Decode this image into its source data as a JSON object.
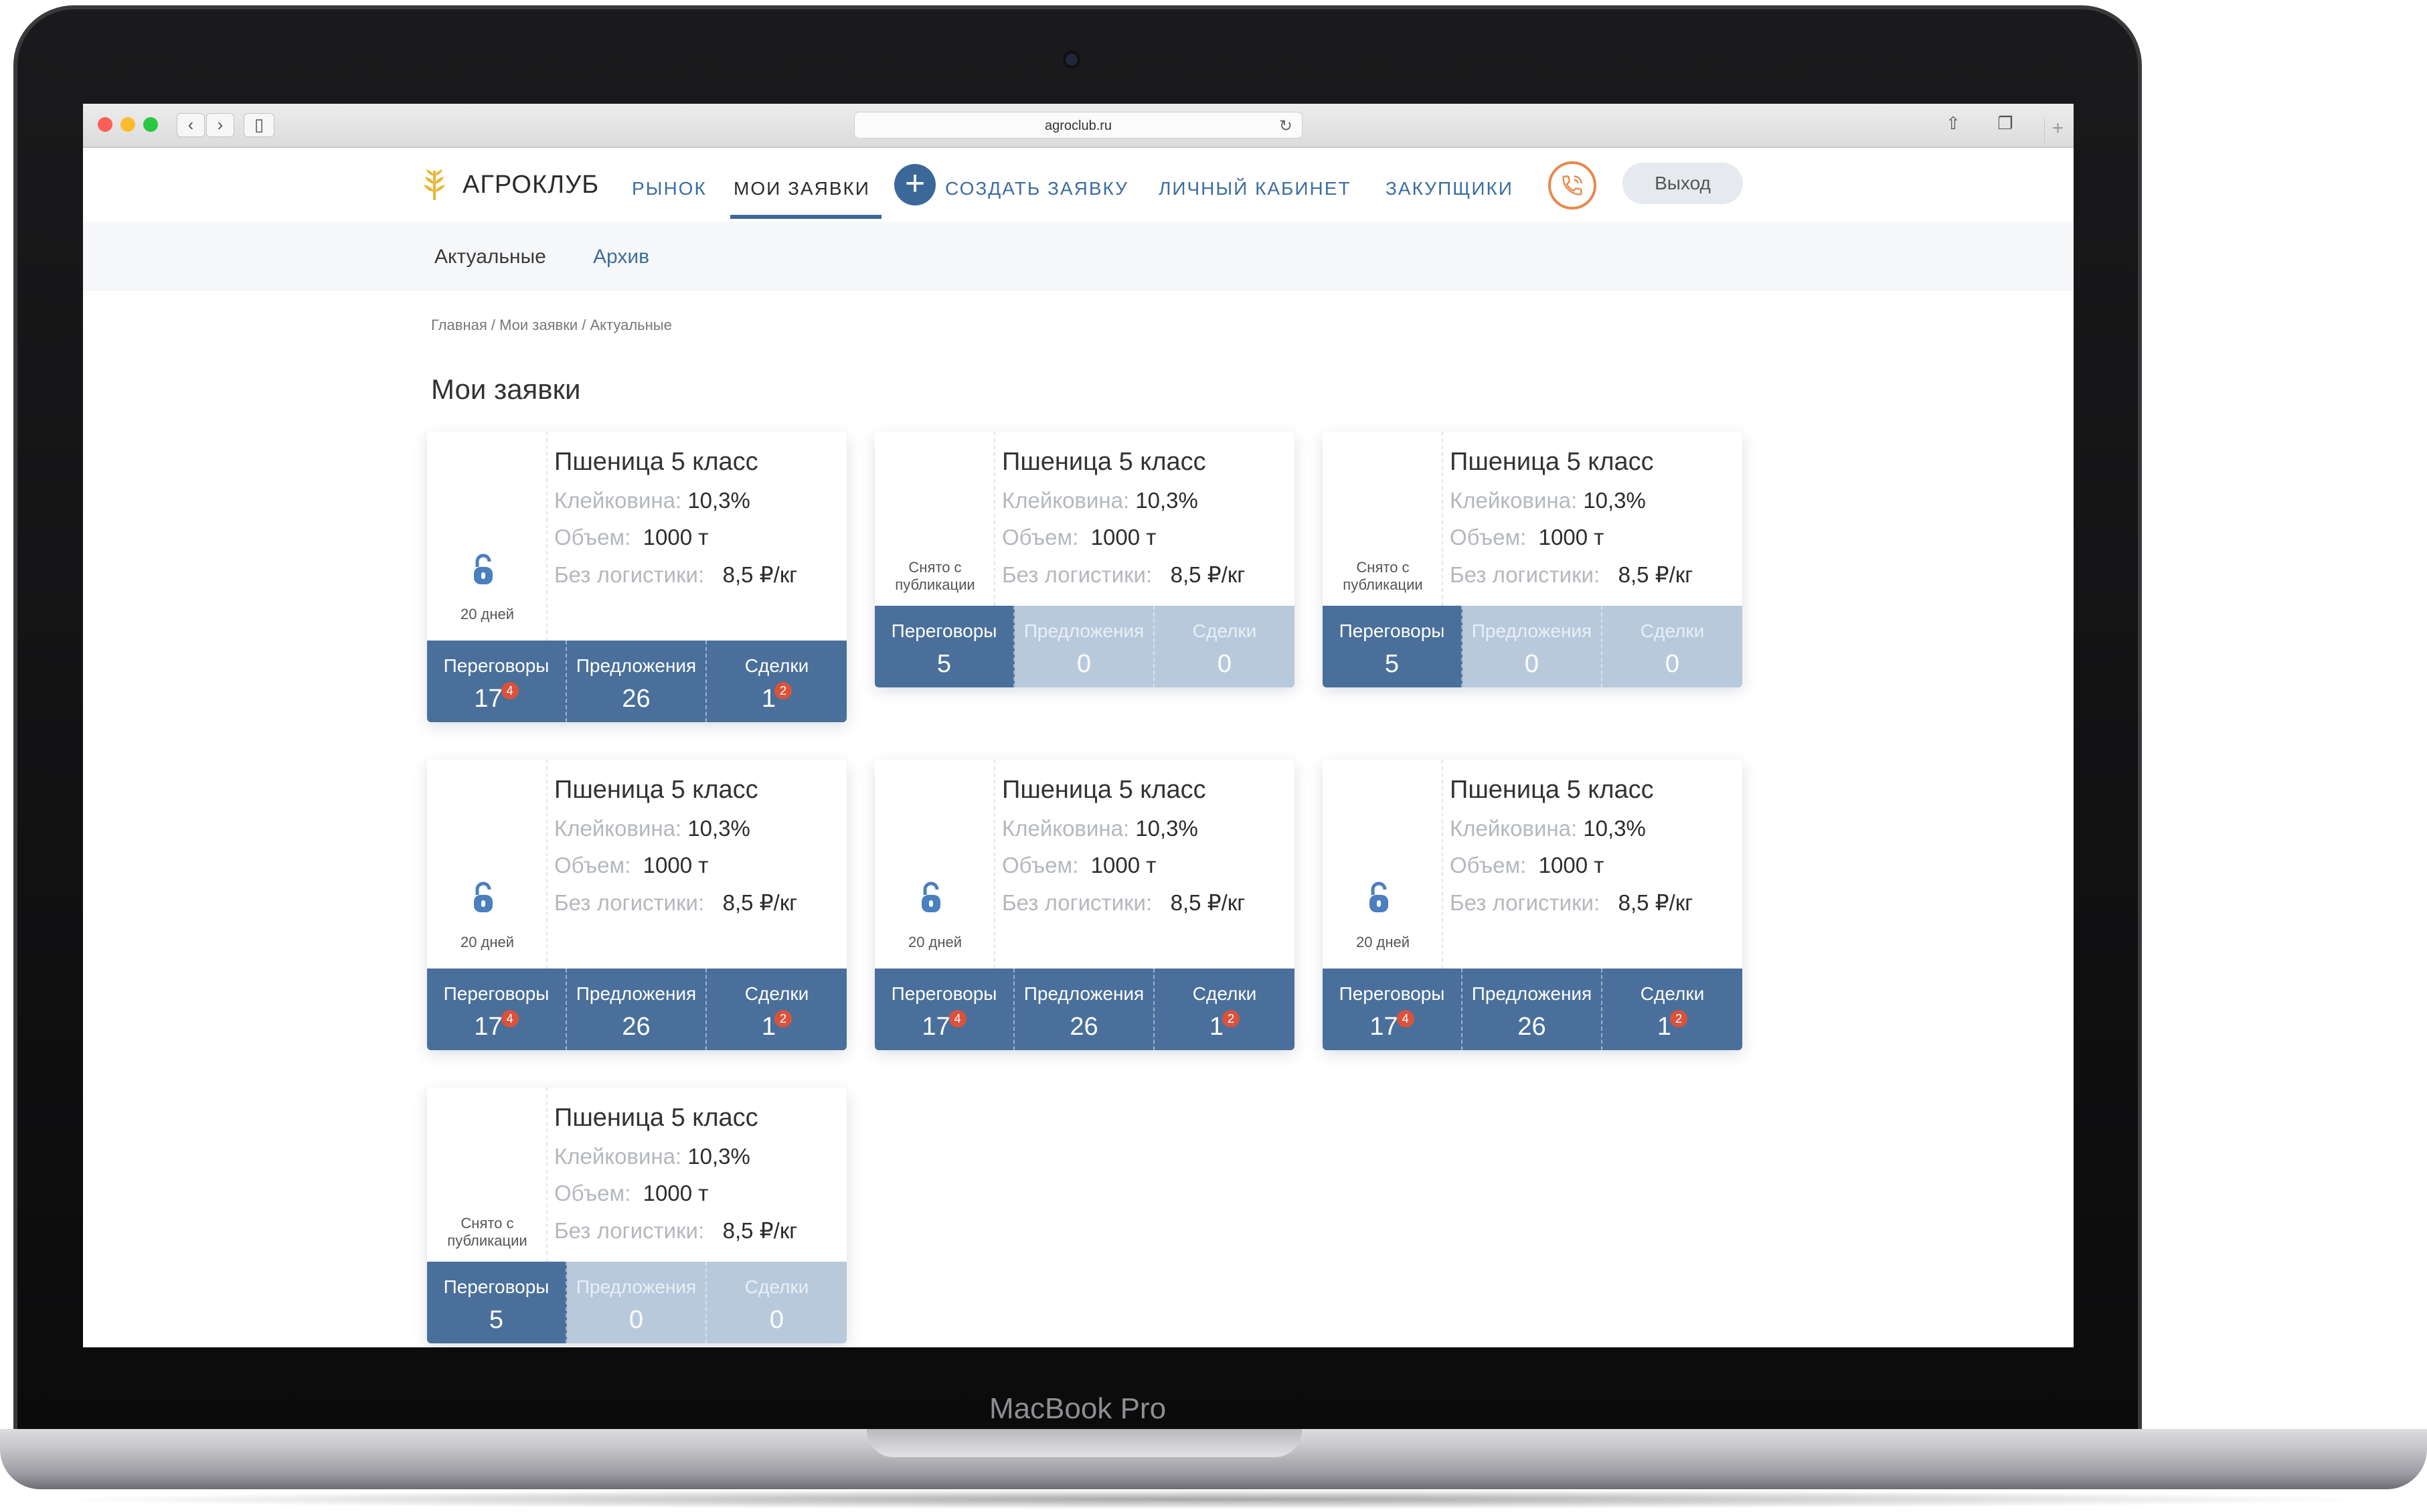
{
  "device": {
    "label": "MacBook Pro"
  },
  "browser": {
    "url": "agroclub.ru"
  },
  "header": {
    "logo_text": "АГРОКЛУБ",
    "nav": {
      "market": "РЫНОК",
      "my_requests": "МОИ ЗАЯВКИ",
      "create_request": "СОЗДАТЬ ЗАЯВКУ",
      "account": "ЛИЧНЫЙ КАБИНЕТ",
      "buyers": "ЗАКУПЩИКИ"
    },
    "exit_label": "Выход",
    "accent_color": "#3c6899",
    "phone_color": "#e8894b"
  },
  "subnav": {
    "active": "Актуальные",
    "archive": "Архив"
  },
  "breadcrumb": "Главная / Мои заявки / Актуальные",
  "page_title": "Мои заявки",
  "spec_labels": {
    "gluten": "Клейковина:",
    "volume": "Объем:",
    "logistics": "Без логистики:"
  },
  "stat_labels": {
    "negotiations": "Переговоры",
    "offers": "Предложения",
    "deals": "Сделки"
  },
  "cards": [
    {
      "title": "Пшеница 5 класс",
      "gluten": "10,3%",
      "volume": "1000 т",
      "price": "8,5 ₽/кг",
      "status": "20 дней",
      "negotiations": "17",
      "negotiations_badge": "4",
      "offers": "26",
      "deals": "1",
      "deals_badge": "2"
    },
    {
      "title": "Пшеница 5 класс",
      "gluten": "10,3%",
      "volume": "1000 т",
      "price": "8,5 ₽/кг",
      "status": "Снято с публикации",
      "negotiations": "5",
      "offers": "0",
      "deals": "0"
    },
    {
      "title": "Пшеница 5 класс",
      "gluten": "10,3%",
      "volume": "1000 т",
      "price": "8,5 ₽/кг",
      "status": "Снято с публикации",
      "negotiations": "5",
      "offers": "0",
      "deals": "0"
    },
    {
      "title": "Пшеница 5 класс",
      "gluten": "10,3%",
      "volume": "1000 т",
      "price": "8,5 ₽/кг",
      "status": "20 дней",
      "negotiations": "17",
      "negotiations_badge": "4",
      "offers": "26",
      "deals": "1",
      "deals_badge": "2"
    },
    {
      "title": "Пшеница 5 класс",
      "gluten": "10,3%",
      "volume": "1000 т",
      "price": "8,5 ₽/кг",
      "status": "20 дней",
      "negotiations": "17",
      "negotiations_badge": "4",
      "offers": "26",
      "deals": "1",
      "deals_badge": "2"
    },
    {
      "title": "Пшеница 5 класс",
      "gluten": "10,3%",
      "volume": "1000 т",
      "price": "8,5 ₽/кг",
      "status": "20 дней",
      "negotiations": "17",
      "negotiations_badge": "4",
      "offers": "26",
      "deals": "1",
      "deals_badge": "2"
    },
    {
      "title": "Пшеница 5 класс",
      "gluten": "10,3%",
      "volume": "1000 т",
      "price": "8,5 ₽/кг",
      "status": "Снято с публикации",
      "negotiations": "5",
      "offers": "0",
      "deals": "0"
    }
  ],
  "colors": {
    "stat_active": "#4a6f9b",
    "stat_inactive": "#b9c9dc",
    "badge": "#d9533c"
  }
}
